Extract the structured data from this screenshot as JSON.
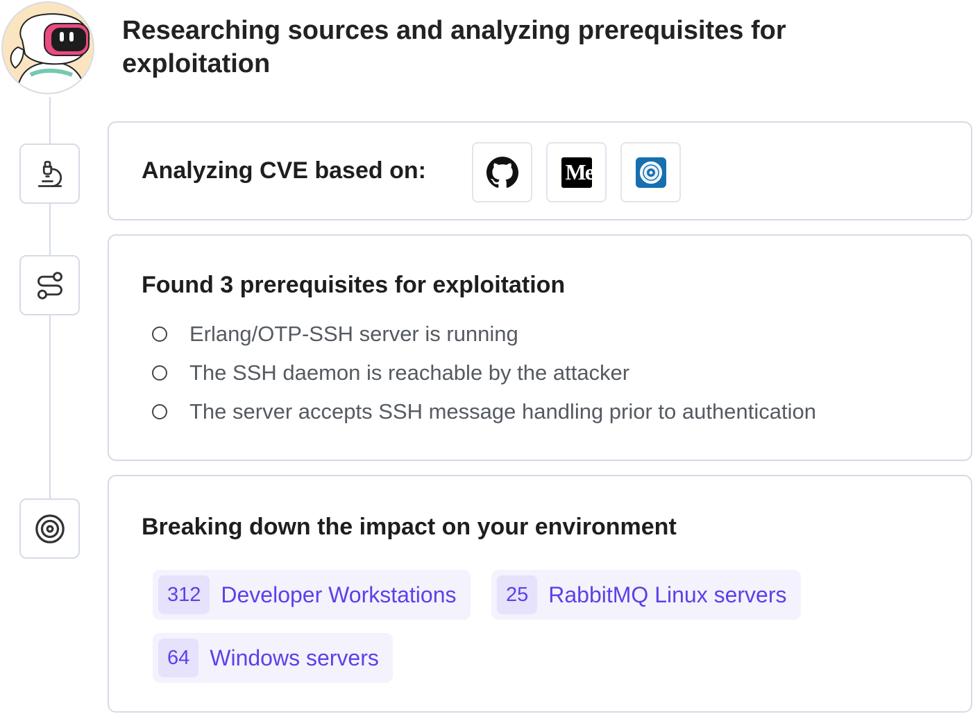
{
  "header": {
    "title": "Researching sources and analyzing prerequisites for exploitation"
  },
  "steps": {
    "analyze": {
      "icon": "microscope-icon",
      "heading": "Analyzing CVE based on:",
      "sources": [
        {
          "icon": "github-icon",
          "name": "GitHub"
        },
        {
          "icon": "medium-icon",
          "name": "Medium",
          "glyph": "Me"
        },
        {
          "icon": "cve-seal-icon",
          "name": "CVE"
        }
      ]
    },
    "prerequisites": {
      "icon": "route-icon",
      "heading": "Found 3 prerequisites for exploitation",
      "items": [
        "Erlang/OTP-SSH server is running",
        "The SSH daemon is reachable by the attacker",
        "The server accepts SSH message handling prior to authentication"
      ]
    },
    "impact": {
      "icon": "target-icon",
      "heading": "Breaking down the impact on your environment",
      "groups": [
        {
          "count": "312",
          "label": "Developer Workstations"
        },
        {
          "count": "25",
          "label": "RabbitMQ Linux servers"
        },
        {
          "count": "64",
          "label": "Windows servers"
        }
      ]
    }
  },
  "colors": {
    "accent": "#5d40e8",
    "chip_bg": "#f4f2fd",
    "border": "#d5dbe6"
  }
}
